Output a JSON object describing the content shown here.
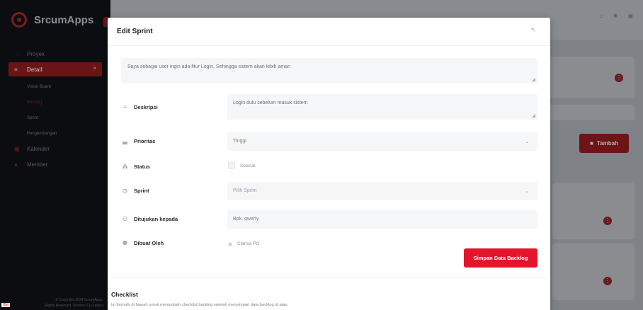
{
  "sidebar": {
    "brand": "SrcumApps",
    "items": [
      {
        "label": "Proyek",
        "icon": "arrow-left-icon"
      },
      {
        "label": "Detail",
        "icon": "list-icon",
        "active": true
      },
      {
        "label": "Kalender",
        "icon": "calendar-icon"
      },
      {
        "label": "Member",
        "icon": "user-icon"
      }
    ],
    "sub_items": [
      "Vision Board",
      "Backlog",
      "Sprint",
      "Pengembangan"
    ],
    "footer_line1": "© Copyright 2024 ScrumApps.",
    "footer_line2": "Rights Reserved. Version 0.1.0-alpha"
  },
  "background": {
    "tambah_label": "Tambah"
  },
  "modal": {
    "title": "Edit Sprint",
    "title_field_value": "Saya sebagai user ingin ada fitur Login, Sehingga sistem akan lebih aman",
    "deskripsi_label": "Deskripsi",
    "deskripsi_value": "Login dulu sebelum masuk sistem",
    "prioritas_label": "Prioritas",
    "prioritas_value": "Tinggi",
    "status_label": "Status",
    "status_checkbox_label": "Selesai",
    "sprint_label": "Sprint",
    "sprint_placeholder": "Pilih Sprint",
    "ditujukan_label": "Ditujukan kepada",
    "ditujukan_value": "Bpk. qwerty",
    "dibuat_label": "Dibuat Oleh",
    "dibuat_value": "Clariva PO",
    "save_label": "Simpan Data Backlog",
    "checklist_title": "Checklist",
    "checklist_desc": "Isi formulir di bawah untuk menambah checklist backlog setelah menyimpan data backlog di atas."
  },
  "colors": {
    "accent": "#e3152a",
    "sidebar_bg": "#0c0d11"
  }
}
